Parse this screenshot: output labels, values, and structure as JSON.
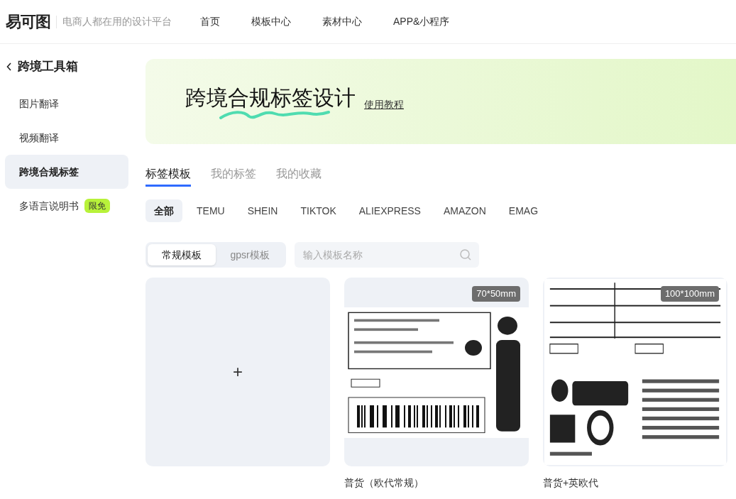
{
  "header": {
    "logo": "易可图",
    "slogan": "电商人都在用的设计平台",
    "nav": [
      "首页",
      "模板中心",
      "素材中心",
      "APP&小程序"
    ]
  },
  "sidebar": {
    "back": "跨境工具箱",
    "items": [
      {
        "label": "图片翻译",
        "selected": false
      },
      {
        "label": "视频翻译",
        "selected": false
      },
      {
        "label": "跨境合规标签",
        "selected": true
      },
      {
        "label": "多语言说明书",
        "selected": false,
        "badge": "限免"
      }
    ]
  },
  "banner": {
    "title": "跨境合规标签设计",
    "link": "使用教程"
  },
  "tabs": [
    {
      "label": "标签模板",
      "selected": true
    },
    {
      "label": "我的标签",
      "selected": false
    },
    {
      "label": "我的收藏",
      "selected": false
    }
  ],
  "platforms": [
    {
      "label": "全部",
      "selected": true
    },
    {
      "label": "TEMU",
      "selected": false
    },
    {
      "label": "SHEIN",
      "selected": false
    },
    {
      "label": "TIKTOK",
      "selected": false
    },
    {
      "label": "ALIEXPRESS",
      "selected": false
    },
    {
      "label": "AMAZON",
      "selected": false
    },
    {
      "label": "EMAG",
      "selected": false
    }
  ],
  "template_types": [
    {
      "label": "常规模板",
      "selected": true
    },
    {
      "label": "gpsr模板",
      "selected": false
    }
  ],
  "search": {
    "placeholder": "输入模板名称"
  },
  "cards": [
    {
      "kind": "new",
      "icon": "+"
    },
    {
      "kind": "template",
      "size": "70*50mm",
      "caption": "普货（欧代常规）"
    },
    {
      "kind": "template",
      "size": "100*100mm",
      "caption": "普货+英欧代"
    }
  ]
}
